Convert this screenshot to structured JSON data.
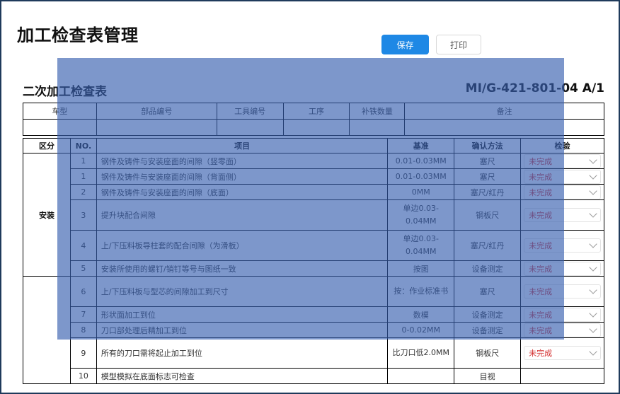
{
  "app": {
    "title": "加工检查表管理"
  },
  "toolbar": {
    "save_label": "保存",
    "print_label": "打印"
  },
  "form": {
    "title": "二次加工检查表",
    "doc_code": "MI/G-421-801-04 A/1"
  },
  "header_table": {
    "columns": [
      "车型",
      "部品编号",
      "工具编号",
      "工序",
      "补铁数量",
      "备注"
    ]
  },
  "main_table": {
    "columns": [
      "区分",
      "NO.",
      "项目",
      "基准",
      "确认方法",
      "检验"
    ],
    "categories": [
      "安装"
    ],
    "status_value": "未完成",
    "rows": [
      {
        "no": "1",
        "item": "钢件及铸件与安装座面的间隙（竖零面）",
        "std": "0.01-0.03MM",
        "method": "塞尺"
      },
      {
        "no": "1",
        "item": "钢件及铸件与安装座面的间隙（背面侧）",
        "std": "0.01-0.03MM",
        "method": "塞尺"
      },
      {
        "no": "2",
        "item": "钢件及铸件与安装座面的间隙（底面）",
        "std": "0MM",
        "method": "塞尺/红丹"
      },
      {
        "no": "3",
        "item": "提升块配合间隙",
        "std": "单边0.03-0.04MM",
        "method": "钢板尺"
      },
      {
        "no": "4",
        "item": "上/下压料板导柱套的配合间隙（为滑板）",
        "std": "单边0.03-0.04MM",
        "method": "塞尺/红丹"
      },
      {
        "no": "5",
        "item": "安装所使用的螺钉/销钉等号与图纸一致",
        "std": "按图",
        "method": "设备测定"
      },
      {
        "no": "6",
        "item": "上/下压料板与型芯的间隙加工到尺寸",
        "std": "按：作业标准书",
        "method": "塞尺"
      },
      {
        "no": "7",
        "item": "形状面加工到位",
        "std": "数模",
        "method": "设备测定"
      },
      {
        "no": "8",
        "item": "刀口部处理后精加工到位",
        "std": "0-0.02MM",
        "method": "设备测定"
      },
      {
        "no": "9",
        "item": "所有的刀口需将起止加工到位",
        "std": "比刀口低2.0MM",
        "method": "钢板尺"
      },
      {
        "no": "10",
        "item": "模型模拟在底面标志可检查",
        "std": "",
        "method": "目视"
      }
    ]
  }
}
